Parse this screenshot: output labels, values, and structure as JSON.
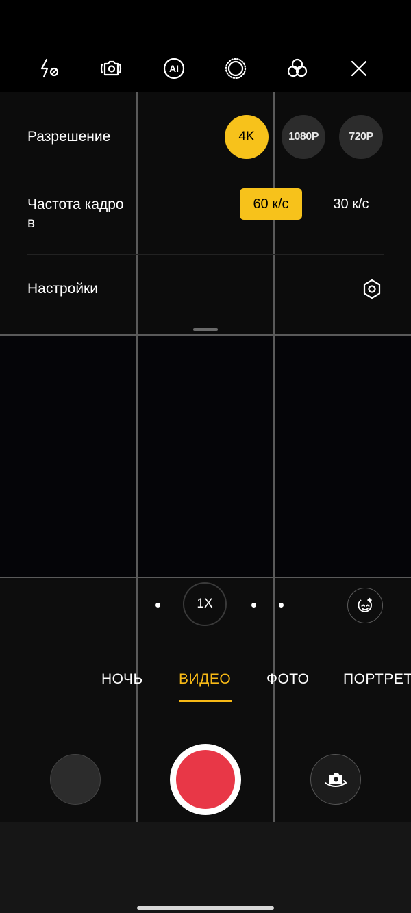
{
  "toolbar": {
    "icons": [
      "flash-off-icon",
      "camera-settings-icon",
      "ai-icon",
      "live-photo-icon",
      "filters-icon",
      "close-icon"
    ],
    "ai_text": "AI"
  },
  "panel": {
    "resolution_label": "Разрешение",
    "resolutions": [
      "4K",
      "1080P",
      "720P"
    ],
    "selected_resolution": "4K",
    "fps_label_line1": "Частота кадро",
    "fps_label_line2": "в",
    "fps_options": [
      "60 к/с",
      "30 к/с"
    ],
    "selected_fps": "60 к/с",
    "settings_label": "Настройки"
  },
  "zoom": {
    "label": "1X"
  },
  "modes": [
    "НОЧЬ",
    "ВИДЕО",
    "ФОТО",
    "ПОРТРЕТ"
  ],
  "active_mode": "ВИДЕО",
  "colors": {
    "accent": "#f7c21b",
    "record": "#e83747"
  }
}
